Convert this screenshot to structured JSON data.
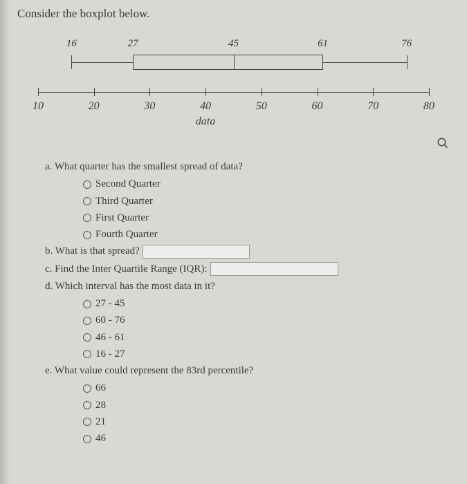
{
  "title": "Consider the boxplot below.",
  "chart_data": {
    "type": "boxplot",
    "min": 16,
    "q1": 27,
    "median": 45,
    "q3": 61,
    "max": 76,
    "xlabel": "data",
    "axis_ticks": [
      10,
      20,
      30,
      40,
      50,
      60,
      70,
      80
    ],
    "xlim": [
      10,
      80
    ]
  },
  "zoom_icon": "zoom-icon",
  "qa": {
    "prompt": "a. What quarter has the smallest spread of data?",
    "options": [
      "Second Quarter",
      "Third Quarter",
      "First Quarter",
      "Fourth Quarter"
    ]
  },
  "qb": {
    "prompt": "b. What is that spread?"
  },
  "qc": {
    "prompt": "c. Find the Inter Quartile Range (IQR):"
  },
  "qd": {
    "prompt": "d. Which interval has the most data in it?",
    "options": [
      "27 - 45",
      "60 - 76",
      "46 - 61",
      "16 - 27"
    ]
  },
  "qe": {
    "prompt": "e. What value could represent the 83rd percentile?",
    "options": [
      "66",
      "28",
      "21",
      "46"
    ]
  }
}
